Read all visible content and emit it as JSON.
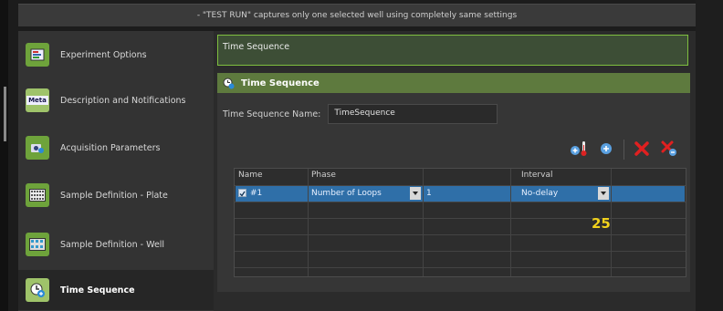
{
  "notice": "- \"TEST RUN\" captures only one selected well using completely same settings",
  "sidebar": {
    "items": [
      {
        "label": "Experiment Options",
        "icon": "experiment-options-icon"
      },
      {
        "label": "Description and Notifications",
        "icon": "meta-icon",
        "icon_text": "Meta"
      },
      {
        "label": "Acquisition Parameters",
        "icon": "camera-icon"
      },
      {
        "label": "Sample Definition - Plate",
        "icon": "plate-grid-icon"
      },
      {
        "label": "Sample Definition - Well",
        "icon": "well-grid-icon"
      },
      {
        "label": "Time Sequence",
        "icon": "time-sequence-icon",
        "active": true
      }
    ]
  },
  "main": {
    "title_field": "Time Sequence",
    "panel_title": "Time Sequence",
    "name_label": "Time Sequence Name:",
    "name_value": "TimeSequence",
    "toolbar": [
      "add-temperature-icon",
      "add-icon",
      "delete-icon",
      "delete-all-icon"
    ],
    "grid": {
      "headers": [
        "Name",
        "Phase",
        "",
        "Interval",
        ""
      ],
      "rows": [
        {
          "checked": true,
          "name": "#1",
          "phase": "Number of Loops",
          "value": "1",
          "interval": "No-delay"
        }
      ]
    }
  },
  "annotation": "25",
  "colors": {
    "accent_green": "#6ea33b",
    "selection_blue": "#2f6fa8",
    "annotation_yellow": "#f1d21c"
  }
}
